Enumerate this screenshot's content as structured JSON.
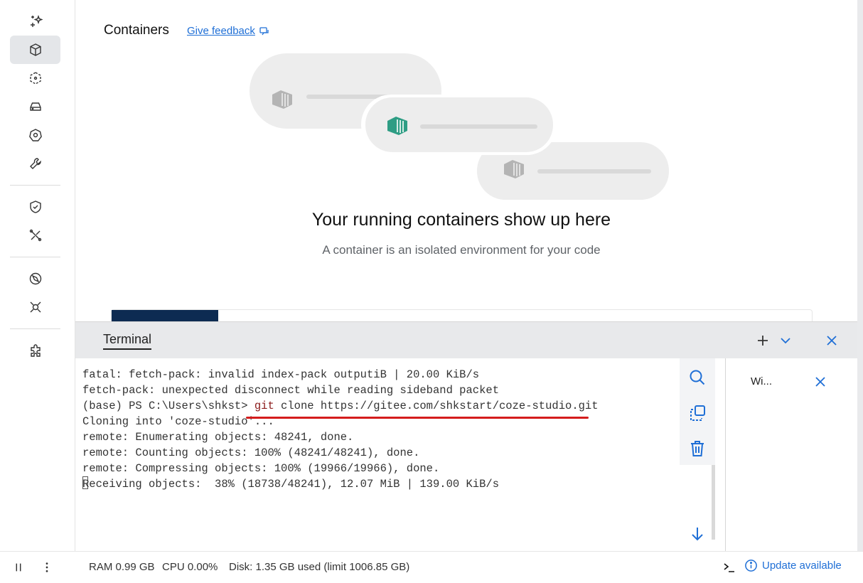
{
  "sidebar": {
    "items": [
      {
        "icon": "sparkles-icon"
      },
      {
        "icon": "containers-icon",
        "active": true
      },
      {
        "icon": "images-icon"
      },
      {
        "icon": "volumes-icon"
      },
      {
        "icon": "kubernetes-icon"
      },
      {
        "icon": "builds-icon"
      },
      {
        "icon": "scout-icon"
      },
      {
        "icon": "models-icon"
      },
      {
        "icon": "learning-center-icon"
      },
      {
        "icon": "mcp-toolkit-icon"
      },
      {
        "icon": "extensions-icon"
      }
    ]
  },
  "header": {
    "title": "Containers",
    "feedback_label": "Give feedback"
  },
  "empty_state": {
    "title": "Your running containers show up here",
    "subtitle": "A container is an isolated environment for your code"
  },
  "terminal": {
    "tab_label": "Terminal",
    "lines": [
      "fatal: fetch-pack: invalid index-pack outputiB | 20.00 KiB/s",
      "fetch-pack: unexpected disconnect while reading sideband packet",
      "(base) PS C:\\Users\\shkst> ",
      "Cloning into 'coze-studio'...",
      "remote: Enumerating objects: 48241, done.",
      "remote: Counting objects: 100% (48241/48241), done.",
      "remote: Compressing objects: 100% (19966/19966), done.",
      "Receiving objects:  38% (18738/48241), 12.07 MiB | 139.00 KiB/s"
    ],
    "command_keyword": "git",
    "command_rest": " clone https://gitee.com/shkstart/coze-studio.git",
    "sessions": [
      {
        "label": "Wi..."
      }
    ]
  },
  "statusbar": {
    "ram": "RAM 0.99 GB",
    "cpu": "CPU 0.00%",
    "disk": "Disk: 1.35 GB used (limit 1006.85 GB)",
    "update_label": "Update available"
  },
  "colors": {
    "accent": "#1f6fd6",
    "underline_red": "#d41c1c",
    "container_green": "#2e9d84"
  }
}
